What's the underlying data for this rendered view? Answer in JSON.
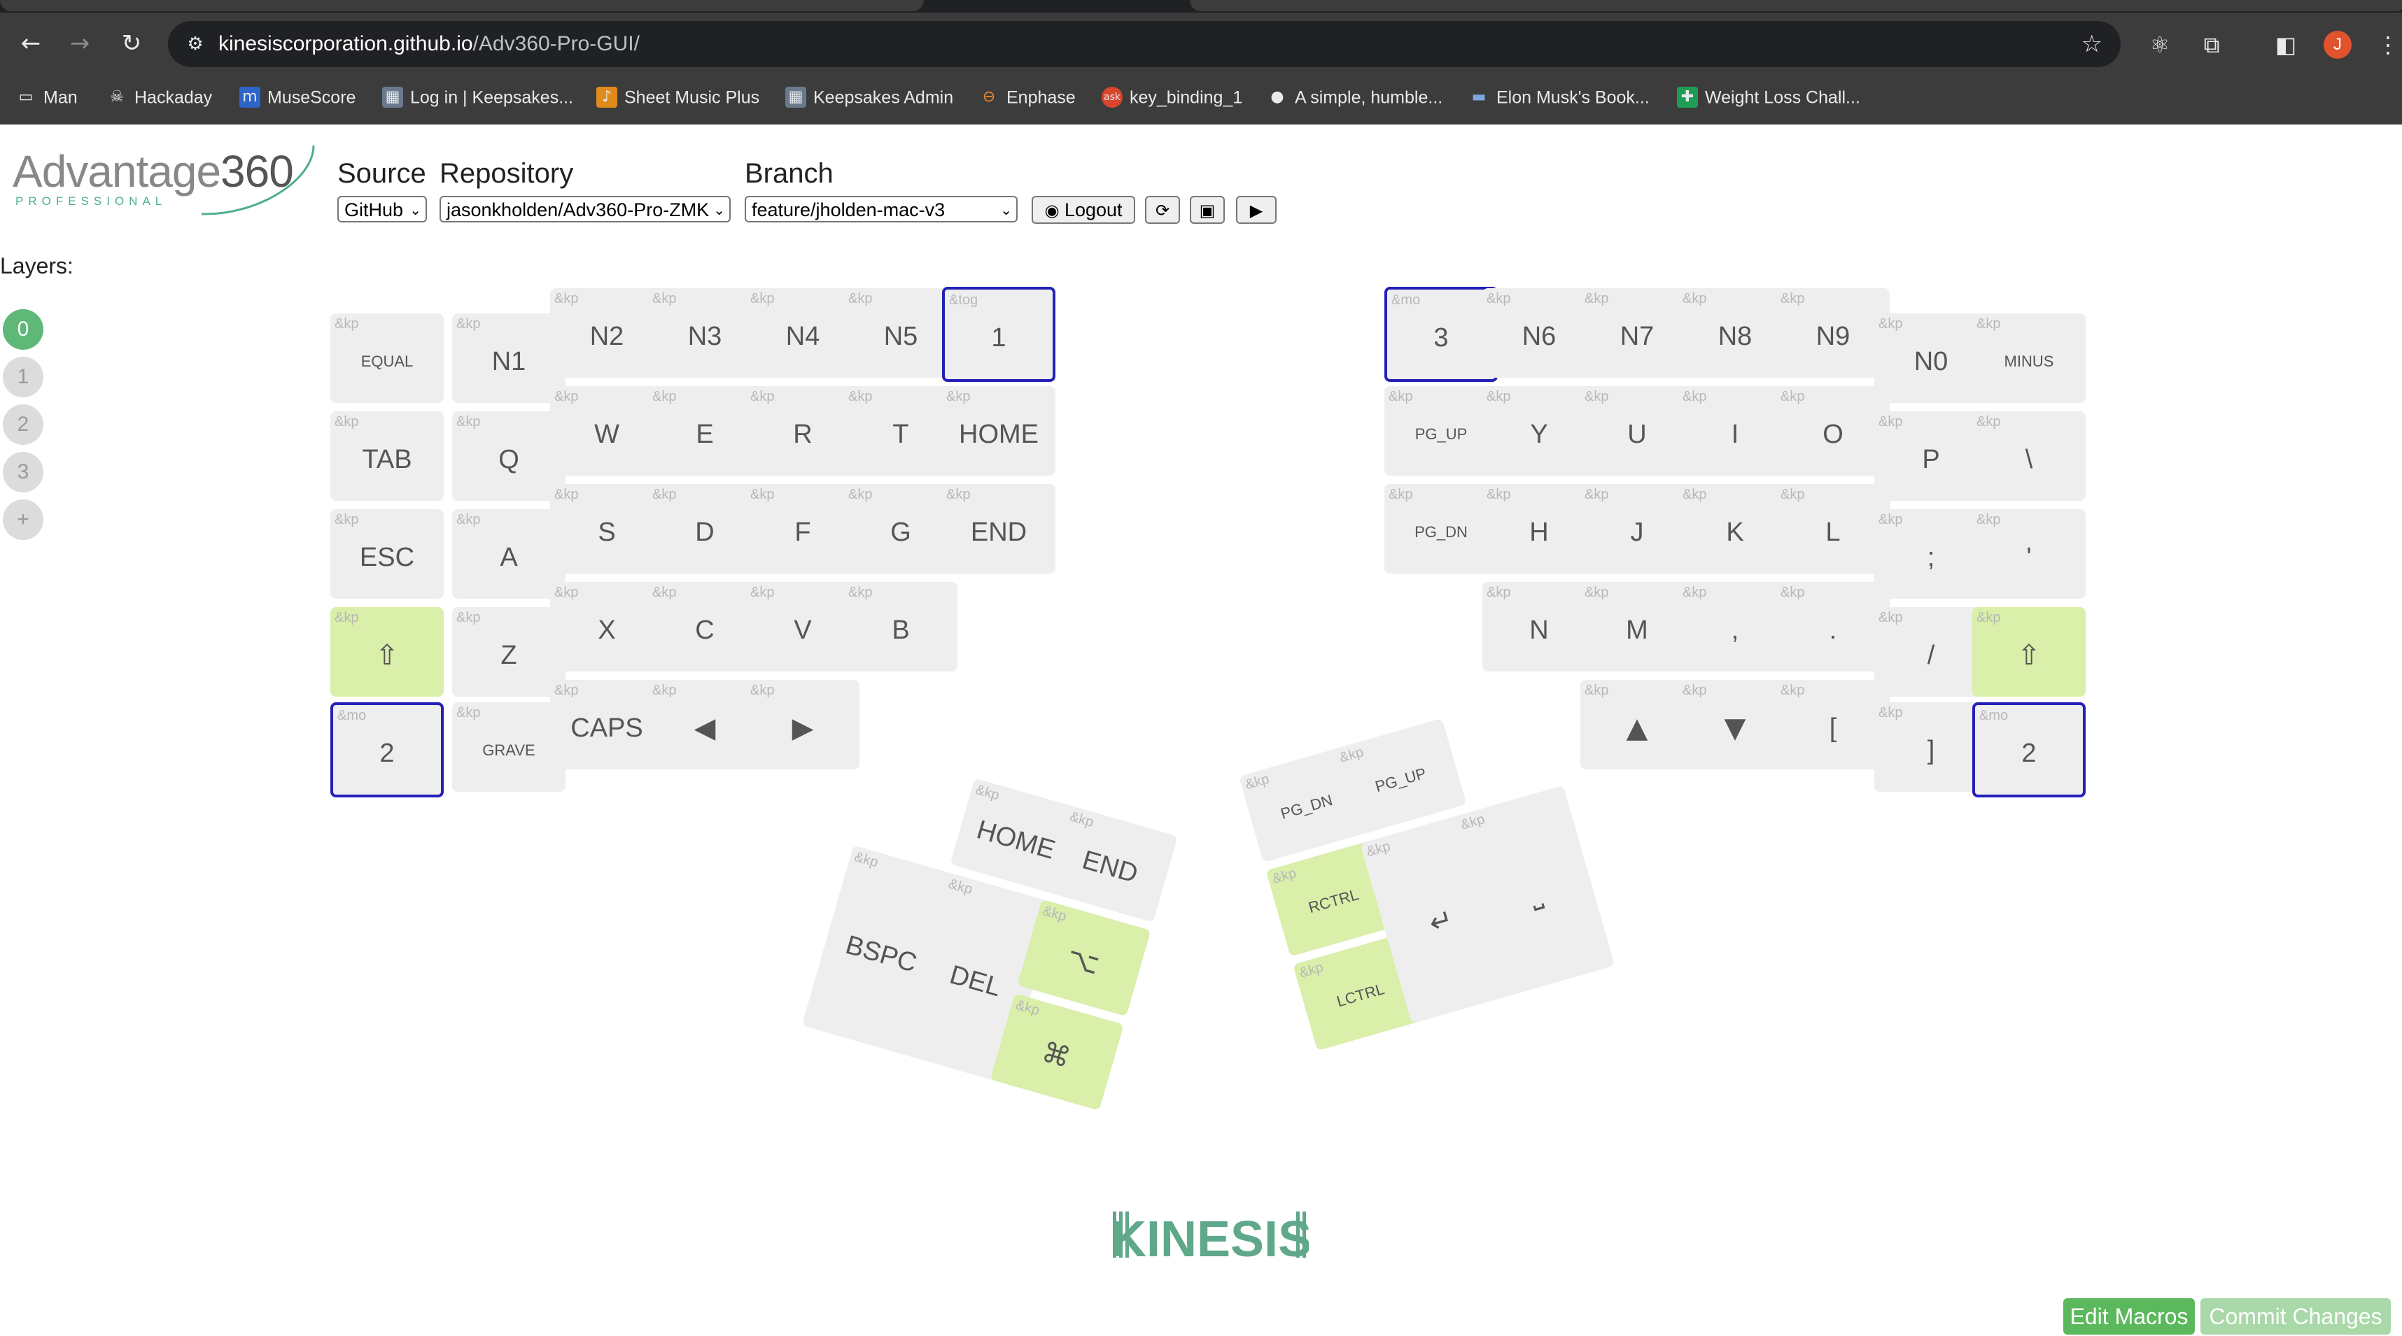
{
  "browser": {
    "url_host": "kinesiscorporation.github.io",
    "url_path": "/Adv360-Pro-GUI/",
    "profile_initial": "J",
    "bookmarks": [
      {
        "label": "Man",
        "icon": "folder-icon"
      },
      {
        "label": "Hackaday",
        "icon": "hackaday-icon"
      },
      {
        "label": "MuseScore",
        "icon": "musescore-icon"
      },
      {
        "label": "Log in | Keepsakes...",
        "icon": "keepsakes-icon"
      },
      {
        "label": "Sheet Music Plus",
        "icon": "sheetmusic-icon"
      },
      {
        "label": "Keepsakes Admin",
        "icon": "keepsakes-icon"
      },
      {
        "label": "Enphase",
        "icon": "enphase-icon"
      },
      {
        "label": "key_binding_1",
        "icon": "ask-icon"
      },
      {
        "label": "A simple, humble...",
        "icon": "medium-icon"
      },
      {
        "label": "Elon Musk's Book...",
        "icon": "book-icon"
      },
      {
        "label": "Weight Loss Chall...",
        "icon": "sheets-icon"
      }
    ]
  },
  "header": {
    "logo_text": "Advantage",
    "logo_number": "360",
    "logo_sub": "PROFESSIONAL",
    "source_label": "Source",
    "source_value": "GitHub",
    "repository_label": "Repository",
    "repository_value": "jasonkholden/Adv360-Pro-ZMK",
    "branch_label": "Branch",
    "branch_value": "feature/jholden-mac-v3",
    "logout_label": "Logout"
  },
  "layers": {
    "label": "Layers:",
    "items": [
      "0",
      "1",
      "2",
      "3"
    ],
    "active": "0",
    "add_label": "+"
  },
  "keys": {
    "left": [
      {
        "b": "&kp",
        "l": "EQUAL"
      },
      {
        "b": "&kp",
        "l": "N1"
      },
      {
        "b": "&kp",
        "l": "N2"
      },
      {
        "b": "&kp",
        "l": "N3"
      },
      {
        "b": "&kp",
        "l": "N4"
      },
      {
        "b": "&kp",
        "l": "N5"
      },
      {
        "b": "&tog",
        "l": "1"
      },
      {
        "b": "&kp",
        "l": "TAB"
      },
      {
        "b": "&kp",
        "l": "Q"
      },
      {
        "b": "&kp",
        "l": "W"
      },
      {
        "b": "&kp",
        "l": "E"
      },
      {
        "b": "&kp",
        "l": "R"
      },
      {
        "b": "&kp",
        "l": "T"
      },
      {
        "b": "&kp",
        "l": "HOME"
      },
      {
        "b": "&kp",
        "l": "ESC"
      },
      {
        "b": "&kp",
        "l": "A"
      },
      {
        "b": "&kp",
        "l": "S"
      },
      {
        "b": "&kp",
        "l": "D"
      },
      {
        "b": "&kp",
        "l": "F"
      },
      {
        "b": "&kp",
        "l": "G"
      },
      {
        "b": "&kp",
        "l": "END"
      },
      {
        "b": "&kp",
        "l": "⇧"
      },
      {
        "b": "&kp",
        "l": "Z"
      },
      {
        "b": "&kp",
        "l": "X"
      },
      {
        "b": "&kp",
        "l": "C"
      },
      {
        "b": "&kp",
        "l": "V"
      },
      {
        "b": "&kp",
        "l": "B"
      },
      {
        "b": "&mo",
        "l": "2"
      },
      {
        "b": "&kp",
        "l": "GRAVE"
      },
      {
        "b": "&kp",
        "l": "CAPS"
      },
      {
        "b": "&kp",
        "l": "◀"
      },
      {
        "b": "&kp",
        "l": "▶"
      }
    ],
    "right": [
      {
        "b": "&mo",
        "l": "3"
      },
      {
        "b": "&kp",
        "l": "N6"
      },
      {
        "b": "&kp",
        "l": "N7"
      },
      {
        "b": "&kp",
        "l": "N8"
      },
      {
        "b": "&kp",
        "l": "N9"
      },
      {
        "b": "&kp",
        "l": "N0"
      },
      {
        "b": "&kp",
        "l": "MINUS"
      },
      {
        "b": "&kp",
        "l": "PG_UP"
      },
      {
        "b": "&kp",
        "l": "Y"
      },
      {
        "b": "&kp",
        "l": "U"
      },
      {
        "b": "&kp",
        "l": "I"
      },
      {
        "b": "&kp",
        "l": "O"
      },
      {
        "b": "&kp",
        "l": "P"
      },
      {
        "b": "&kp",
        "l": "\\"
      },
      {
        "b": "&kp",
        "l": "PG_DN"
      },
      {
        "b": "&kp",
        "l": "H"
      },
      {
        "b": "&kp",
        "l": "J"
      },
      {
        "b": "&kp",
        "l": "K"
      },
      {
        "b": "&kp",
        "l": "L"
      },
      {
        "b": "&kp",
        "l": ";"
      },
      {
        "b": "&kp",
        "l": "'"
      },
      {
        "b": "&kp",
        "l": "N"
      },
      {
        "b": "&kp",
        "l": "M"
      },
      {
        "b": "&kp",
        "l": ","
      },
      {
        "b": "&kp",
        "l": "."
      },
      {
        "b": "&kp",
        "l": "/"
      },
      {
        "b": "&kp",
        "l": "⇧"
      },
      {
        "b": "&kp",
        "l": "▲"
      },
      {
        "b": "&kp",
        "l": "▼"
      },
      {
        "b": "&kp",
        "l": "["
      },
      {
        "b": "&kp",
        "l": "]"
      },
      {
        "b": "&mo",
        "l": "2"
      }
    ],
    "left_thumb": [
      {
        "b": "&kp",
        "l": "HOME"
      },
      {
        "b": "&kp",
        "l": "END"
      },
      {
        "b": "&kp",
        "l": "BSPC"
      },
      {
        "b": "&kp",
        "l": "DEL"
      },
      {
        "b": "&kp",
        "l": "⌥"
      },
      {
        "b": "&kp",
        "l": "⌘"
      }
    ],
    "right_thumb": [
      {
        "b": "&kp",
        "l": "PG_DN"
      },
      {
        "b": "&kp",
        "l": "PG_UP"
      },
      {
        "b": "&kp",
        "l": "RCTRL"
      },
      {
        "b": "&kp",
        "l": "↵"
      },
      {
        "b": "&kp",
        "l": "⎵"
      },
      {
        "b": "&kp",
        "l": "LCTRL"
      }
    ]
  },
  "footer": {
    "brand": "KINESIS",
    "edit_macros_label": "Edit Macros",
    "commit_label": "Commit Changes",
    "edit_color": "#5cb85c",
    "commit_color": "#a9d8a9"
  }
}
